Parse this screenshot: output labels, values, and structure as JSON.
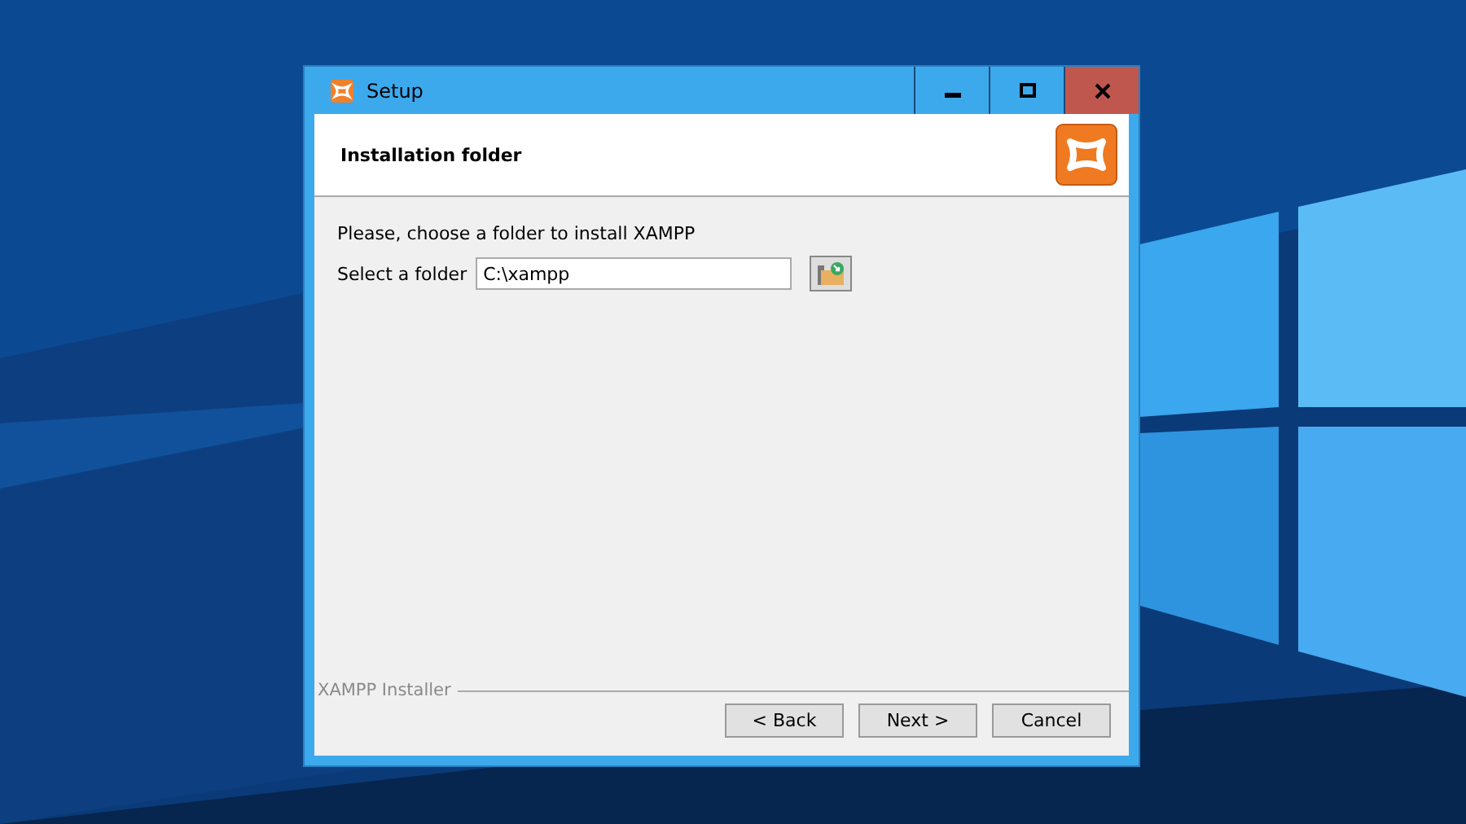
{
  "window": {
    "title": "Setup"
  },
  "header": {
    "title": "Installation folder"
  },
  "content": {
    "instruction": "Please, choose a folder to install XAMPP",
    "folder_label": "Select a folder",
    "folder_value": "C:\\xampp"
  },
  "footer": {
    "group_label": "XAMPP Installer"
  },
  "buttons": [
    {
      "label": "< Back"
    },
    {
      "label": "Next >"
    },
    {
      "label": "Cancel"
    }
  ]
}
